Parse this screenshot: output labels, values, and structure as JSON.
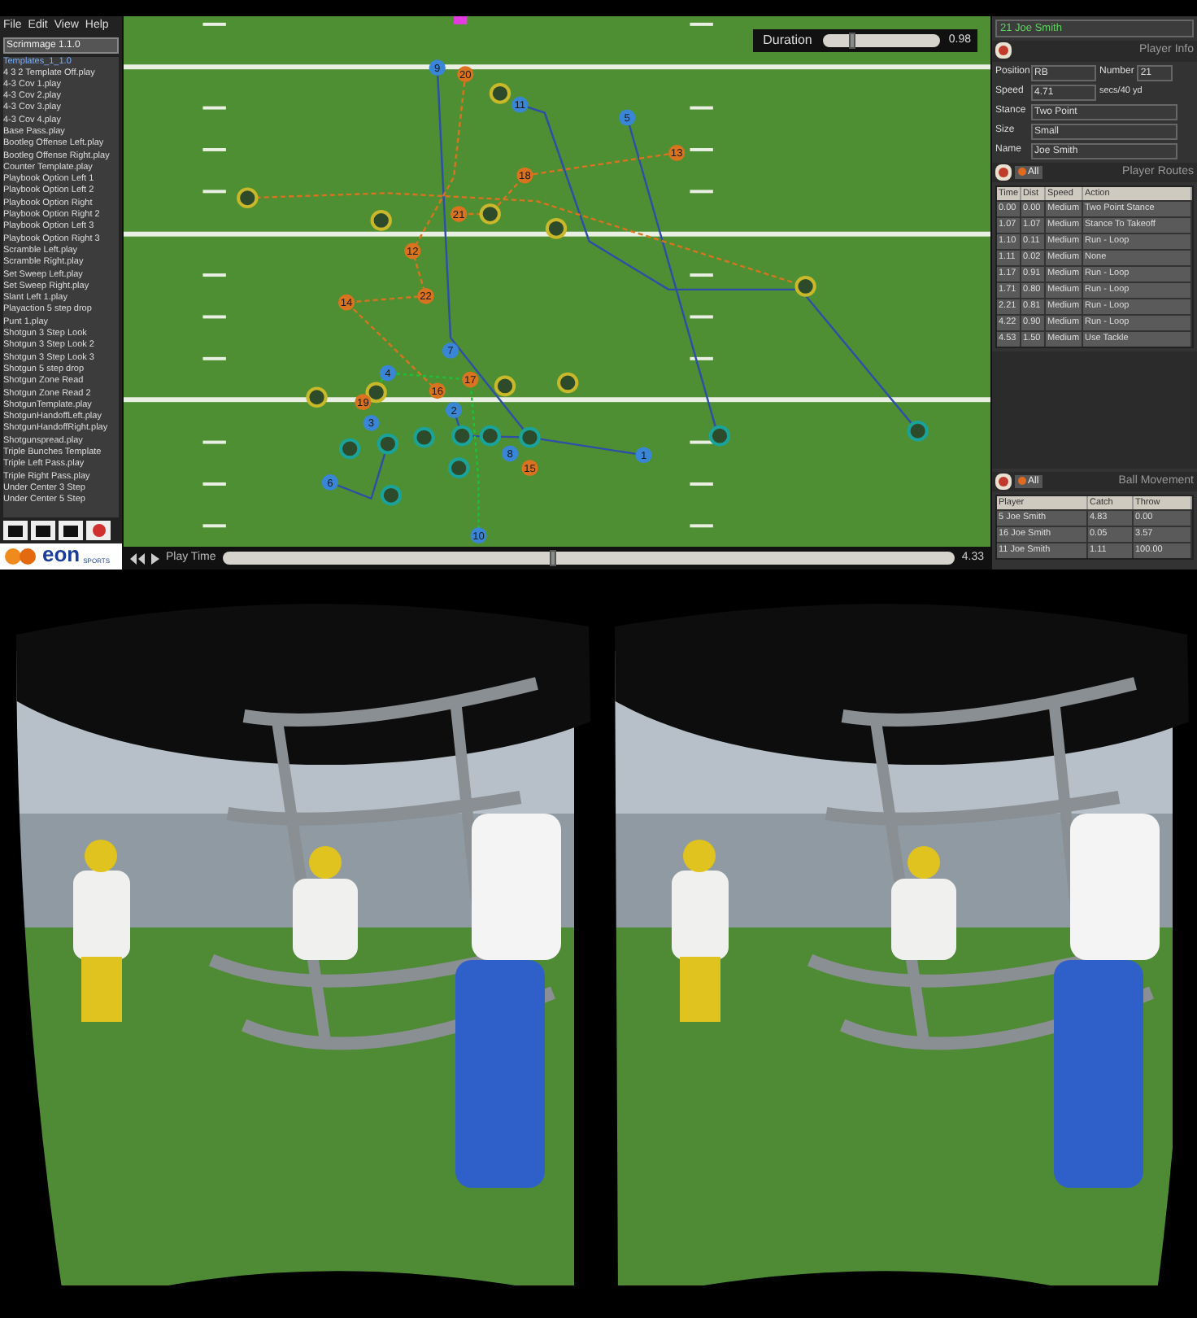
{
  "menu": [
    "File",
    "Edit",
    "View",
    "Help"
  ],
  "playbook": {
    "value": "Scrimmage 1.1.0",
    "folder": "Templates_1_1.0"
  },
  "plays": [
    "4 3 2 Template Off.play",
    "4-3 Cov 1.play",
    "4-3 Cov 2.play",
    "4-3 Cov 3.play",
    "4-3 Cov 4.play",
    "Base Pass.play",
    "Bootleg Offense Left.play",
    "Bootleg Offense Right.play",
    "Counter Template.play",
    "Playbook Option Left 1",
    "Playbook Option Left 2",
    "Playbook Option Right",
    "Playbook Option Right 2",
    "Playbook Option Left 3",
    "Playbook Option Right 3",
    "Scramble Left.play",
    "Scramble Right.play",
    "Set Sweep Left.play",
    "Set Sweep Right.play",
    "Slant Left 1.play",
    "Playaction 5 step drop",
    "Punt 1.play",
    "Shotgun 3 Step Look",
    "Shotgun 3 Step Look 2",
    "Shotgun 3 Step Look 3",
    "Shotgun 5 step drop",
    "Shotgun Zone Read",
    "Shotgun Zone Read 2",
    "ShotgunTemplate.play",
    "ShotgunHandoffLeft.play",
    "ShotgunHandoffRight.play",
    "Shotgunspread.play",
    "Triple Bunches Template",
    "Triple Left Pass.play",
    "Triple Right Pass.play",
    "Under Center 3 Step",
    "Under Center 5 Step"
  ],
  "logo": {
    "name": "eon",
    "tagline": "SPORTS"
  },
  "duration": {
    "label": "Duration",
    "level": 0.25,
    "reading": "0.98"
  },
  "markers": [
    {
      "label": "9",
      "color": "#3a86d6"
    },
    {
      "label": "20",
      "color": "#d9731f"
    },
    {
      "label": "11",
      "color": "#3a86d6"
    },
    {
      "label": "5",
      "color": "#3a86d6"
    },
    {
      "label": "13",
      "color": "#d9731f"
    },
    {
      "label": "18",
      "color": "#d9731f"
    },
    {
      "label": "21",
      "color": "#d9731f"
    },
    {
      "label": "12",
      "color": "#d9731f"
    },
    {
      "label": "22",
      "color": "#d9731f"
    },
    {
      "label": "14",
      "color": "#d9731f"
    },
    {
      "label": "7",
      "color": "#3a86d6"
    },
    {
      "label": "4",
      "color": "#3a86d6"
    },
    {
      "label": "16",
      "color": "#d9731f"
    },
    {
      "label": "17",
      "color": "#d9731f"
    },
    {
      "label": "19",
      "color": "#d9731f"
    },
    {
      "label": "3",
      "color": "#3a86d6"
    },
    {
      "label": "2",
      "color": "#3a86d6"
    },
    {
      "label": "8",
      "color": "#3a86d6"
    },
    {
      "label": "15",
      "color": "#d9731f"
    },
    {
      "label": "1",
      "color": "#3a86d6"
    },
    {
      "label": "6",
      "color": "#3a86d6"
    },
    {
      "label": "10",
      "color": "#3a86d6"
    }
  ],
  "playback": {
    "label": "Play Time",
    "level": 0.45,
    "reading": "4.33"
  },
  "player": {
    "selector": "21 Joe Smith",
    "title": "Player Info",
    "fields": [
      {
        "label": "Position",
        "value": "RB"
      },
      {
        "label": "Number",
        "value": "21"
      },
      {
        "label": "Speed",
        "value": "4.71"
      },
      {
        "label": "Stance",
        "value": "Two Point"
      },
      {
        "label": "Size",
        "value": "Small"
      },
      {
        "label": "Name",
        "value": "Joe Smith"
      }
    ],
    "speed_unit": "secs/40 yd"
  },
  "routes": {
    "title": "Player Routes",
    "button": "All",
    "columns": [
      "Time",
      "Dist",
      "Speed",
      "Action"
    ],
    "rows": [
      [
        "0.00",
        "0.00",
        "Medium",
        "Two Point Stance"
      ],
      [
        "1.07",
        "1.07",
        "Medium",
        "Stance To Takeoff"
      ],
      [
        "1.10",
        "0.11",
        "Medium",
        "Run - Loop"
      ],
      [
        "1.11",
        "0.02",
        "Medium",
        "None"
      ],
      [
        "1.17",
        "0.91",
        "Medium",
        "Run - Loop"
      ],
      [
        "1.71",
        "0.80",
        "Medium",
        "Run - Loop"
      ],
      [
        "2.21",
        "0.81",
        "Medium",
        "Run - Loop"
      ],
      [
        "4.22",
        "0.90",
        "Medium",
        "Run - Loop"
      ],
      [
        "4.53",
        "1.50",
        "Medium",
        "Use Tackle"
      ]
    ]
  },
  "ball": {
    "title": "Ball Movement",
    "button": "All",
    "columns": [
      "Player",
      "Catch",
      "Throw"
    ],
    "rows": [
      [
        "5 Joe Smith",
        "4.83",
        "0.00"
      ],
      [
        "16 Joe Smith",
        "0.05",
        "3.57"
      ],
      [
        "11 Joe Smith",
        "1.11",
        "100.00"
      ]
    ]
  }
}
